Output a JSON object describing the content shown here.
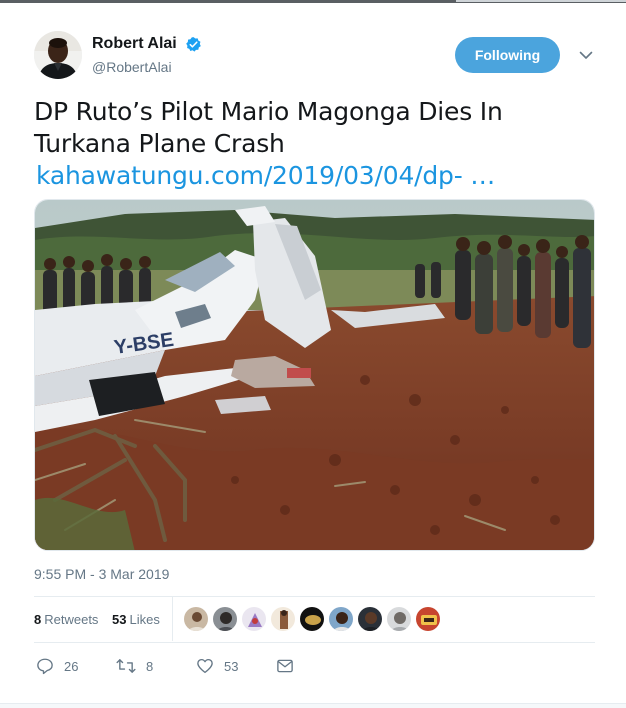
{
  "author": {
    "display_name": "Robert Alai",
    "handle": "@RobertAlai",
    "verified_icon": "verified-badge-icon"
  },
  "follow_button": {
    "label": "Following"
  },
  "tweet": {
    "text": "DP Ruto’s Pilot Mario Magonga Dies In Turkana Plane Crash",
    "link": "kahawatungu.com/2019/03/04/dp-  …",
    "media_description_hidden": "",
    "timestamp": "9:55 PM - 3 Mar 2019"
  },
  "stats": {
    "retweets_count": "8",
    "retweets_label": "Retweets",
    "likes_count": "53",
    "likes_label": "Likes"
  },
  "actions": {
    "reply_count": "26",
    "retweet_count": "8",
    "like_count": "53"
  },
  "colors": {
    "accent": "#1b95e0",
    "button": "#4ba4dd",
    "secondary_text": "#657786"
  }
}
